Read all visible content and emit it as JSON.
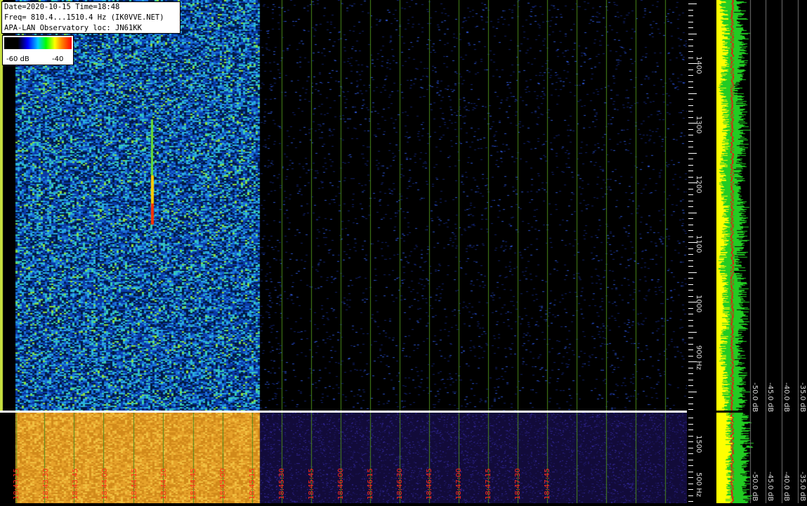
{
  "info": {
    "line1": "Date=2020-10-15 Time=18:48",
    "line2": "Freq= 810.4...1510.4 Hz (IK0VVE.NET)",
    "line3": "APA-LAN Observatory loc: JN61KK"
  },
  "legend": {
    "min": "-60 dB",
    "max": "-40"
  },
  "time_axis": {
    "labels": [
      "18:43:15",
      "18:43:30",
      "18:43:45",
      "18:44:00",
      "18:44:15",
      "18:44:30",
      "18:44:45",
      "18:45:00",
      "18:45:15",
      "18:45:30",
      "18:45:45",
      "18:46:00",
      "18:46:15",
      "18:46:30",
      "18:46:45",
      "18:47:00",
      "18:47:15",
      "18:47:30",
      "18:47:45"
    ]
  },
  "freq_axis": {
    "labels": [
      "1400",
      "1300",
      "1200",
      "1100",
      "1000",
      "900 Hz"
    ],
    "bottom_labels": [
      "1500",
      "500 Hz"
    ]
  },
  "spectrum_axis": {
    "labels": [
      "-50.0 dB",
      "-45.0 dB",
      "-40.0 dB",
      "-35.0 dB"
    ]
  },
  "colors": {
    "info_bg": "#ffffff",
    "grid_line": "#4a8a1a",
    "time_label": "#ff2a1a",
    "spectrum_yellow": "#ffff00",
    "spectrum_green": "#22cc22",
    "spectrum_red": "#ee1111"
  }
}
